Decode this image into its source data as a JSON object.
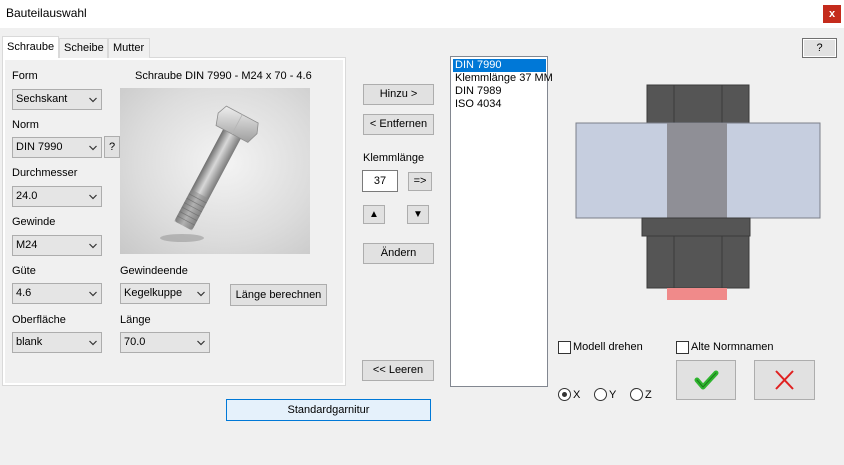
{
  "window": {
    "title": "Bauteilauswahl",
    "close_glyph": "x",
    "help_label": "?"
  },
  "tabs": [
    {
      "label": "Schraube",
      "active": true
    },
    {
      "label": "Scheibe",
      "active": false
    },
    {
      "label": "Mutter",
      "active": false
    }
  ],
  "form": {
    "form_label": "Form",
    "form_value": "Sechskant",
    "norm_label": "Norm",
    "norm_value": "DIN 7990",
    "norm_help": "?",
    "durchmesser_label": "Durchmesser",
    "durchmesser_value": "24.0",
    "gewinde_label": "Gewinde",
    "gewinde_value": "M24",
    "guete_label": "Güte",
    "guete_value": "4.6",
    "gewindeende_label": "Gewindeende",
    "gewindeende_value": "Kegelkuppe",
    "laenge_berechnen": "Länge berechnen",
    "oberflaeche_label": "Oberfläche",
    "oberflaeche_value": "blank",
    "laenge_label": "Länge",
    "laenge_value": "70.0"
  },
  "preview": {
    "caption": "Schraube DIN 7990 - M24 x 70 - 4.6"
  },
  "actions": {
    "hinzu": "Hinzu >",
    "entfernen": "< Entfernen",
    "klemmlaenge_label": "Klemmlänge",
    "klemmlaenge_value": "37",
    "apply_glyph": "=>",
    "up_glyph": "▲",
    "down_glyph": "▼",
    "aendern": "Ändern",
    "leeren": "<< Leeren",
    "standardgarnitur": "Standardgarnitur"
  },
  "list": {
    "items": [
      "DIN 7990",
      "Klemmlänge 37 MM",
      "DIN 7989",
      "ISO 4034"
    ],
    "selected_index": 0
  },
  "options": {
    "modell_drehen": "Modell drehen",
    "alte_normnamen": "Alte Normnamen",
    "axis_x": "X",
    "axis_y": "Y",
    "axis_z": "Z",
    "selected_axis": "X"
  },
  "colors": {
    "accent": "#0078d7",
    "plate": "#c6ceDF",
    "steel_dark": "#555555",
    "shaft": "#8f8f96",
    "thread_end": "#f08a8a",
    "ok_green": "#2fb52f",
    "cancel_red": "#e02020",
    "close_red": "#c42b1c"
  }
}
